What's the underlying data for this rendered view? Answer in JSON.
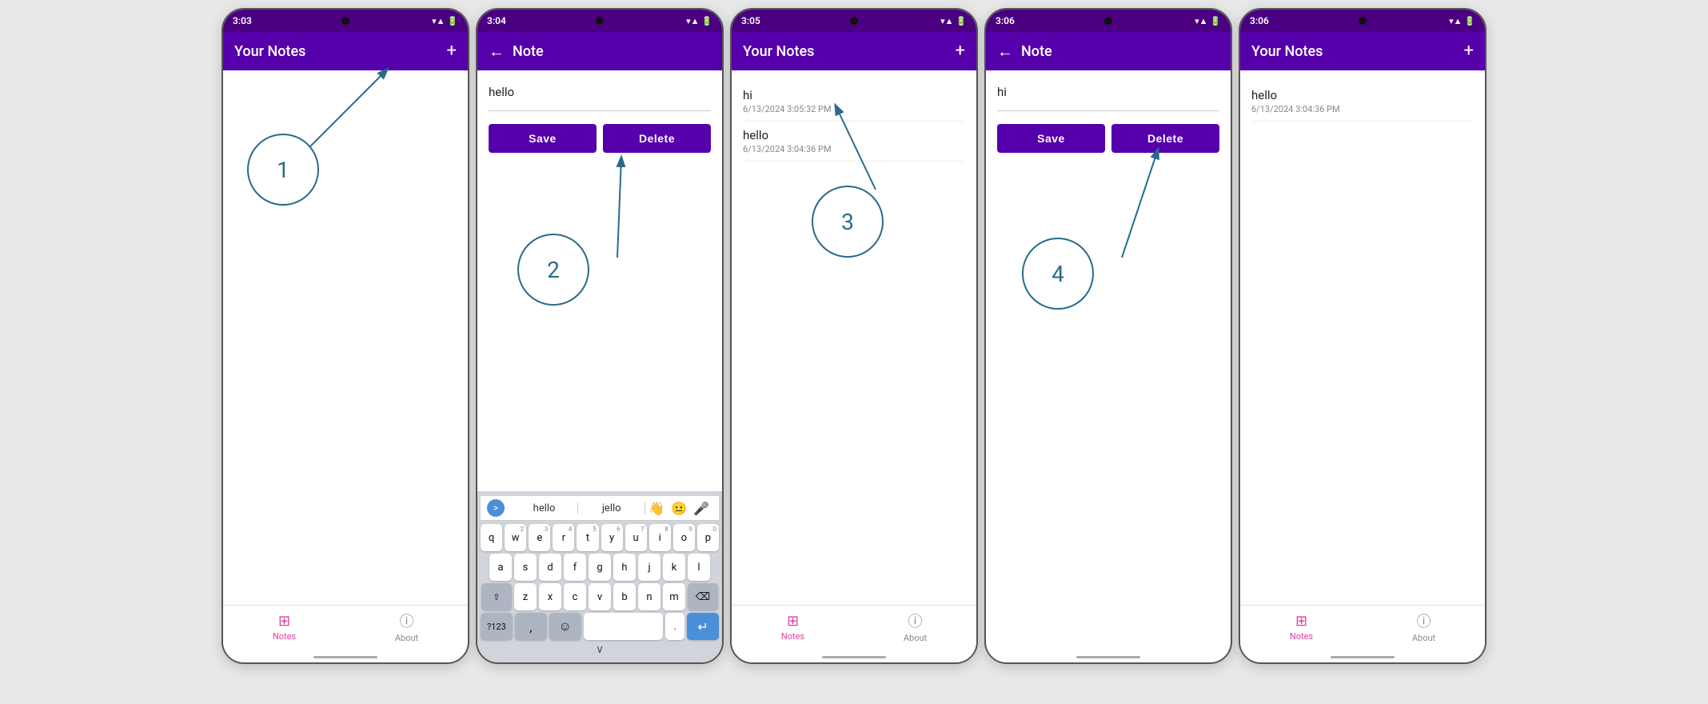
{
  "phones": [
    {
      "id": "phone1",
      "statusBar": {
        "time": "3:03",
        "icons": "▾▲⬡",
        "batteryWifi": "▼▲▰"
      },
      "appBar": {
        "title": "Your Notes",
        "hasBack": false,
        "hasPlus": true
      },
      "screen": "list-empty",
      "annotationNumber": "1",
      "notes": [],
      "bottomNav": true
    },
    {
      "id": "phone2",
      "statusBar": {
        "time": "3:04"
      },
      "appBar": {
        "title": "Note",
        "hasBack": true,
        "hasPlus": false
      },
      "screen": "editor",
      "noteContent": "hello",
      "annotationNumber": "2",
      "showKeyboard": true,
      "bottomNav": false
    },
    {
      "id": "phone3",
      "statusBar": {
        "time": "3:05"
      },
      "appBar": {
        "title": "Your Notes",
        "hasBack": false,
        "hasPlus": true
      },
      "screen": "list-two",
      "annotationNumber": "3",
      "notes": [
        {
          "title": "hi",
          "date": "6/13/2024 3:05:32 PM"
        },
        {
          "title": "hello",
          "date": "6/13/2024 3:04:36 PM"
        }
      ],
      "bottomNav": true
    },
    {
      "id": "phone4",
      "statusBar": {
        "time": "3:06"
      },
      "appBar": {
        "title": "Note",
        "hasBack": true,
        "hasPlus": false
      },
      "screen": "editor",
      "noteContent": "hi",
      "annotationNumber": "4",
      "showKeyboard": false,
      "bottomNav": false
    },
    {
      "id": "phone5",
      "statusBar": {
        "time": "3:06"
      },
      "appBar": {
        "title": "Your Notes",
        "hasBack": false,
        "hasPlus": true
      },
      "screen": "list-two-v2",
      "annotationNumber": null,
      "notes": [
        {
          "title": "hello",
          "date": "6/13/2024 3:04:36 PM"
        }
      ],
      "bottomNav": true
    }
  ],
  "ui": {
    "saveLabel": "Save",
    "deleteLabel": "Delete",
    "notesNavLabel": "Notes",
    "aboutNavLabel": "About",
    "backArrow": "←",
    "plusIcon": "+",
    "keyboardSuggestions": [
      "hello",
      "jello"
    ],
    "keyboardEmoji1": "👋",
    "keyboardEmoji2": "😐",
    "keysRow1": [
      "q",
      "w",
      "e",
      "r",
      "t",
      "y",
      "u",
      "i",
      "o",
      "p"
    ],
    "keysRow1Numbers": [
      "",
      "2",
      "3",
      "4",
      "5",
      "6",
      "7",
      "8",
      "9",
      "0"
    ],
    "keysRow2": [
      "a",
      "s",
      "d",
      "f",
      "g",
      "h",
      "j",
      "k",
      "l"
    ],
    "keysRow3": [
      "z",
      "x",
      "c",
      "v",
      "b",
      "n",
      "m"
    ],
    "keyNumbers": "?123",
    "keyComma": ",",
    "keyDot": ".",
    "keyEnter": "↵",
    "keyChevronDown": "∨"
  },
  "colors": {
    "purple": "#5500aa",
    "purpleDark": "#4a0080",
    "pink": "#e040a0",
    "blue": "#4a90d9",
    "annotationCircle": "#2a6b8a"
  }
}
